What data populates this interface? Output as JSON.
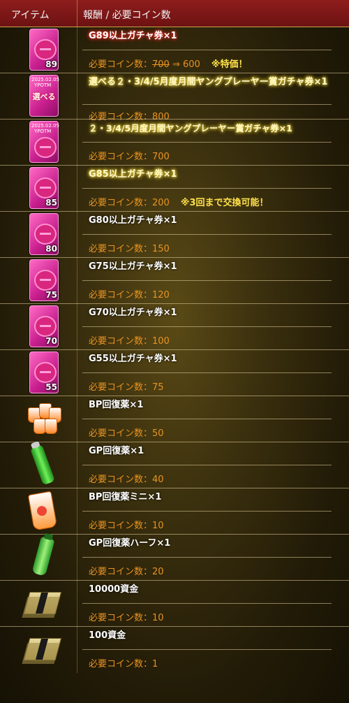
{
  "header": {
    "col_item": "アイテム",
    "col_reward": "報酬 / 必要コイン数"
  },
  "cost_label": "必要コイン数：",
  "rows": [
    {
      "name": "G89以上ガチャ券×1",
      "old": "700",
      "arrow": " ⇒ ",
      "value": "600",
      "note": "※特価！",
      "icon": "ticket-icon",
      "badge": "89"
    },
    {
      "name": "選べる２・3/4/5月度月間ヤングプレーヤー賞ガチャ券×1",
      "value": "800",
      "icon": "ticket-icon",
      "badge": "",
      "date": "2025.02.05",
      "ticket_text": "YPOTM",
      "ticket_label": "選べる"
    },
    {
      "name": "２・3/4/5月度月間ヤングプレーヤー賞ガチャ券×1",
      "value": "700",
      "icon": "ticket-icon",
      "badge": "",
      "date": "2025.02.05",
      "ticket_text": "YPOTM"
    },
    {
      "name": "G85以上ガチャ券×1",
      "value": "200",
      "note": "※3回まで交換可能！",
      "icon": "ticket-icon",
      "badge": "85"
    },
    {
      "name": "G80以上ガチャ券×1",
      "value": "150",
      "icon": "ticket-icon",
      "badge": "80"
    },
    {
      "name": "G75以上ガチャ券×1",
      "value": "120",
      "icon": "ticket-icon",
      "badge": "75"
    },
    {
      "name": "G70以上ガチャ券×1",
      "value": "100",
      "icon": "ticket-icon",
      "badge": "70"
    },
    {
      "name": "G55以上ガチャ券×1",
      "value": "75",
      "icon": "ticket-icon",
      "badge": "55"
    },
    {
      "name": "BP回復薬×1",
      "value": "50",
      "icon": "bp-recovery-icon"
    },
    {
      "name": "GP回復薬×1",
      "value": "40",
      "icon": "gp-recovery-icon"
    },
    {
      "name": "BP回復薬ミニ×1",
      "value": "10",
      "icon": "bp-recovery-mini-icon"
    },
    {
      "name": "GP回復薬ハーフ×1",
      "value": "20",
      "icon": "gp-recovery-half-icon"
    },
    {
      "name": "10000資金",
      "value": "10",
      "icon": "money-icon"
    },
    {
      "name": "100資金",
      "value": "1",
      "icon": "money-icon"
    }
  ],
  "colors": {
    "header_bg": "#8e1d1d",
    "cost_text": "#e99320",
    "note_text": "#ffe14a"
  }
}
